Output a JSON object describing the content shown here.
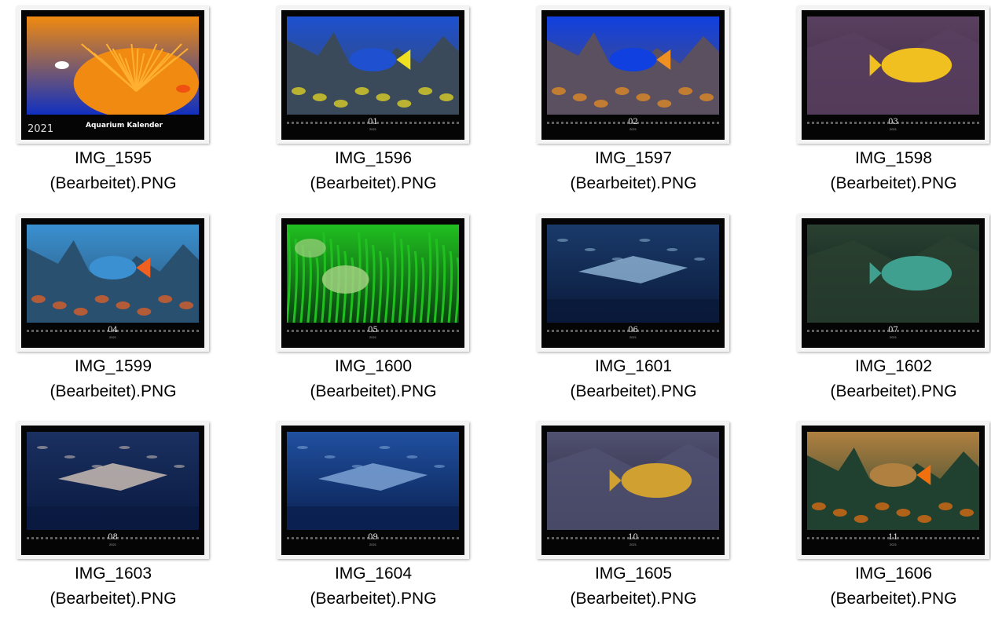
{
  "files": [
    {
      "line1": "IMG_1595",
      "line2": "(Bearbeitet).PNG",
      "month": "",
      "year": "2021",
      "cover_title": "Aquarium Kalender",
      "theme": "cover",
      "colors": [
        "#1030c0",
        "#f08a10",
        "#ffb030"
      ]
    },
    {
      "line1": "IMG_1596",
      "line2": "(Bearbeitet).PNG",
      "month": "01",
      "year": "2021",
      "theme": "reef",
      "colors": [
        "#3a4a5a",
        "#1e50d0",
        "#f0e020"
      ]
    },
    {
      "line1": "IMG_1597",
      "line2": "(Bearbeitet).PNG",
      "month": "02",
      "year": "2021",
      "theme": "reef",
      "colors": [
        "#5a5060",
        "#1040e0",
        "#f09020"
      ]
    },
    {
      "line1": "IMG_1598",
      "line2": "(Bearbeitet).PNG",
      "month": "03",
      "year": "2021",
      "theme": "rock",
      "colors": [
        "#3a2a40",
        "#5a4060",
        "#f0c020"
      ]
    },
    {
      "line1": "IMG_1599",
      "line2": "(Bearbeitet).PNG",
      "month": "04",
      "year": "2021",
      "theme": "reef",
      "colors": [
        "#2a5070",
        "#3a90d0",
        "#f06020"
      ]
    },
    {
      "line1": "IMG_1600",
      "line2": "(Bearbeitet).PNG",
      "month": "05",
      "year": "2021",
      "theme": "plants",
      "colors": [
        "#0a4010",
        "#20c020",
        "#a0d080"
      ]
    },
    {
      "line1": "IMG_1601",
      "line2": "(Bearbeitet).PNG",
      "month": "06",
      "year": "2021",
      "theme": "deep",
      "colors": [
        "#0a1a3a",
        "#1a3a6a",
        "#9ac0e0"
      ]
    },
    {
      "line1": "IMG_1602",
      "line2": "(Bearbeitet).PNG",
      "month": "07",
      "year": "2021",
      "theme": "rock",
      "colors": [
        "#0a2020",
        "#2a4030",
        "#40a090"
      ]
    },
    {
      "line1": "IMG_1603",
      "line2": "(Bearbeitet).PNG",
      "month": "08",
      "year": "2021",
      "theme": "deep",
      "colors": [
        "#0a1a40",
        "#1a3060",
        "#e0d0c0"
      ]
    },
    {
      "line1": "IMG_1604",
      "line2": "(Bearbeitet).PNG",
      "month": "09",
      "year": "2021",
      "theme": "deep",
      "colors": [
        "#0a2050",
        "#2050a0",
        "#8ab0e0"
      ]
    },
    {
      "line1": "IMG_1605",
      "line2": "(Bearbeitet).PNG",
      "month": "10",
      "year": "2021",
      "theme": "rock",
      "colors": [
        "#2a2a40",
        "#505070",
        "#d0a030"
      ]
    },
    {
      "line1": "IMG_1606",
      "line2": "(Bearbeitet).PNG",
      "month": "11",
      "year": "2021",
      "theme": "reef",
      "colors": [
        "#204030",
        "#b08040",
        "#f07010"
      ]
    }
  ]
}
